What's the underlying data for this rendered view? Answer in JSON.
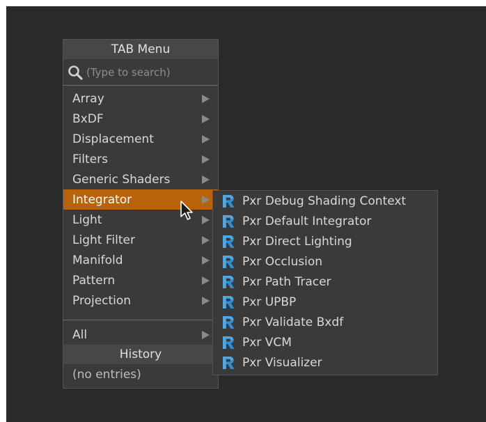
{
  "tab_menu": {
    "title": "TAB Menu",
    "search_placeholder": "(Type to search)",
    "categories": [
      {
        "label": "Array"
      },
      {
        "label": "BxDF"
      },
      {
        "label": "Displacement"
      },
      {
        "label": "Filters"
      },
      {
        "label": "Generic Shaders"
      },
      {
        "label": "Integrator",
        "active": true
      },
      {
        "label": "Light"
      },
      {
        "label": "Light Filter"
      },
      {
        "label": "Manifold"
      },
      {
        "label": "Pattern"
      },
      {
        "label": "Projection"
      }
    ],
    "all_label": "All",
    "history_title": "History",
    "history_empty": "(no entries)"
  },
  "submenu": {
    "items": [
      "Pxr Debug Shading Context",
      "Pxr Default Integrator",
      "Pxr Direct Lighting",
      "Pxr Occlusion",
      "Pxr Path Tracer",
      "Pxr UPBP",
      "Pxr Validate Bxdf",
      "Pxr VCM",
      "Pxr Visualizer"
    ]
  },
  "colors": {
    "background": "#2a2a2a",
    "menu_bg": "#3a3a3a",
    "header_bg": "#474747",
    "highlight": "#b8620a",
    "renderman_icon": "#2f8fd6"
  },
  "icons": {
    "search": "magnifier-icon",
    "submenu_arrow": "right-triangle-icon",
    "item": "renderman-r-icon",
    "pointer": "mouse-cursor-icon"
  }
}
